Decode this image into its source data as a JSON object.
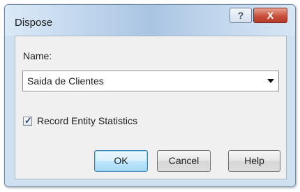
{
  "window": {
    "title": "Dispose",
    "help_glyph": "?",
    "close_glyph": "X"
  },
  "form": {
    "name_label": "Name:",
    "name_value": "Saida de Clientes",
    "record_stats_label": "Record Entity Statistics",
    "record_stats_checked": true,
    "check_glyph": "✓"
  },
  "buttons": {
    "ok": "OK",
    "cancel": "Cancel",
    "help": "Help"
  },
  "colors": {
    "close_button": "#c9503c",
    "default_button_border": "#3c7fb1"
  }
}
